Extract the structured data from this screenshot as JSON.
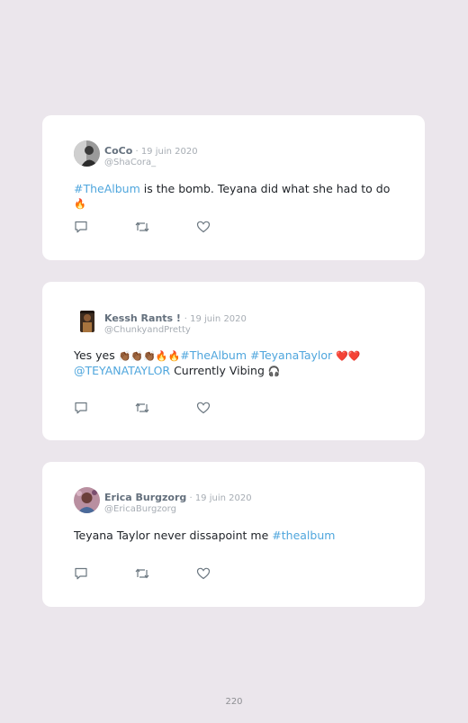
{
  "tweets": [
    {
      "name": "CoCo",
      "sep": " · ",
      "date": "19 juin 2020",
      "handle": "@ShaCora_",
      "parts": [
        {
          "t": "#TheAlbum",
          "tag": true
        },
        {
          "t": " is the bomb. Teyana did what she had to do ",
          "tag": false
        },
        {
          "t": "🔥",
          "emoji": true
        }
      ]
    },
    {
      "name": "Kessh Rants ! ",
      "sep": "· ",
      "date": "19 juin 2020",
      "handle": "@ChunkyandPretty",
      "parts": [
        {
          "t": "Yes yes ",
          "tag": false
        },
        {
          "t": "👏🏾👏🏾👏🏾🔥🔥",
          "emoji": true
        },
        {
          "t": "#TheAlbum",
          "tag": true
        },
        {
          "t": " ",
          "tag": false
        },
        {
          "t": "#TeyanaTaylor",
          "tag": true
        },
        {
          "t": " ",
          "tag": false
        },
        {
          "t": "❤️❤️",
          "emoji": true
        },
        {
          "t": "\n",
          "tag": false
        },
        {
          "t": "@TEYANATAYLOR",
          "tag": true
        },
        {
          "t": " Currently Vibing ",
          "tag": false
        },
        {
          "t": "🎧",
          "emoji": true
        }
      ]
    },
    {
      "name": "Erica Burgzorg",
      "sep": " · ",
      "date": "19 juin 2020",
      "handle": "@EricaBurgzorg",
      "parts": [
        {
          "t": "Teyana Taylor never dissapoint me ",
          "tag": false
        },
        {
          "t": "#thealbum",
          "tag": true
        }
      ]
    }
  ],
  "icons": [
    "reply-icon",
    "retweet-icon",
    "like-icon"
  ],
  "colors": {
    "hashtag": "#4fa6dd",
    "background": "#ebe6ec",
    "card": "#ffffff"
  },
  "page_number": "220"
}
